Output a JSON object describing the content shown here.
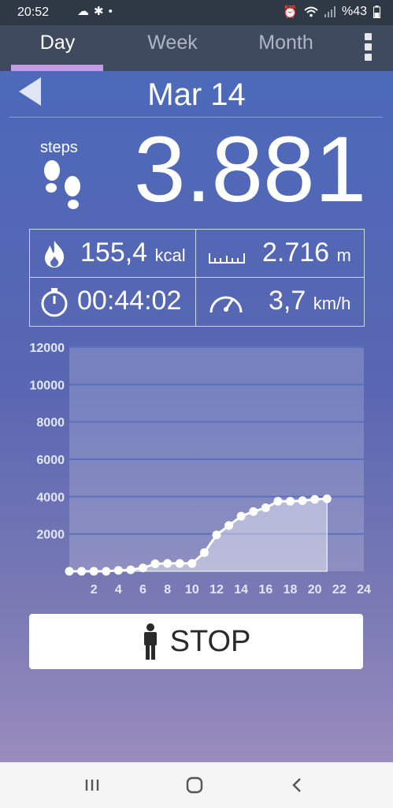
{
  "status_bar": {
    "time": "20:52",
    "left_icons": [
      "cloud-icon",
      "gear-icon",
      "dot-icon"
    ],
    "right_icons": [
      "alarm-icon",
      "wifi-icon",
      "signal-icon",
      "battery-icon"
    ],
    "battery": "%43"
  },
  "tabs": [
    {
      "label": "Day",
      "selected": true
    },
    {
      "label": "Week",
      "selected": false
    },
    {
      "label": "Month",
      "selected": false
    }
  ],
  "header": {
    "date": "Mar 14"
  },
  "summary": {
    "steps_label": "steps",
    "steps": "3.881"
  },
  "stats": {
    "calories": {
      "value": "155,4",
      "unit": "kcal",
      "icon": "flame-icon"
    },
    "distance": {
      "value": "2.716",
      "unit": "m",
      "icon": "ruler-icon"
    },
    "duration": {
      "value": "00:44:02",
      "icon": "stopwatch-icon"
    },
    "speed": {
      "value": "3,7",
      "unit": "km/h",
      "icon": "speedometer-icon"
    }
  },
  "chart_data": {
    "type": "area",
    "title": "",
    "xlabel": "",
    "ylabel": "",
    "xlim": [
      0,
      24
    ],
    "ylim": [
      0,
      12000
    ],
    "x_ticks": [
      2,
      4,
      6,
      8,
      10,
      12,
      14,
      16,
      18,
      20,
      22,
      24
    ],
    "y_ticks": [
      2000,
      4000,
      6000,
      8000,
      10000,
      12000
    ],
    "grid": true,
    "x": [
      0,
      1,
      2,
      3,
      4,
      5,
      6,
      7,
      8,
      9,
      10,
      11,
      12,
      13,
      14,
      15,
      16,
      17,
      18,
      19,
      20,
      21
    ],
    "series": [
      {
        "values": [
          0,
          0,
          0,
          0,
          50,
          80,
          180,
          400,
          420,
          420,
          420,
          1000,
          1950,
          2450,
          2950,
          3200,
          3400,
          3750,
          3750,
          3780,
          3850,
          3881
        ]
      }
    ],
    "colors": {
      "line": "#ffffff",
      "fill": "rgba(255,255,255,0.4)",
      "plot_bg": "rgba(255,255,255,0.18)",
      "grid": "#5b6fbf"
    }
  },
  "stop_button": {
    "label": "STOP",
    "icon": "person-icon"
  },
  "nav_bar": {
    "icons": [
      "recents-icon",
      "home-icon",
      "back-icon"
    ]
  }
}
